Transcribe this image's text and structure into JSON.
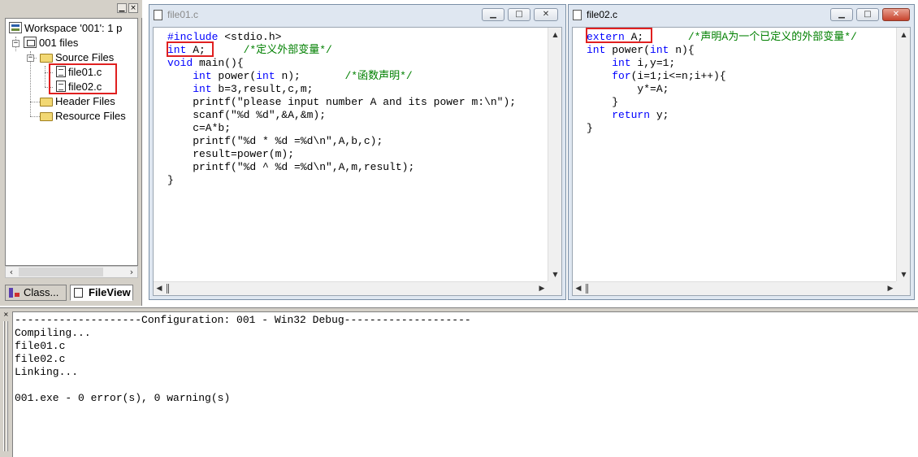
{
  "workspace": {
    "root_label": "Workspace '001': 1 p",
    "project_label": "001 files",
    "folders": {
      "source": "Source Files",
      "header": "Header Files",
      "resource": "Resource Files"
    },
    "files": [
      "file01.c",
      "file02.c"
    ],
    "tabs": [
      {
        "label": "Class...",
        "icon": "class-view-icon",
        "active": false
      },
      {
        "label": "FileView",
        "icon": "file-view-icon",
        "active": true
      }
    ]
  },
  "editors": [
    {
      "title": "file01.c",
      "active": false,
      "lines": [
        [
          {
            "t": "#include",
            "c": "kw"
          },
          {
            "t": " <stdio.h>",
            "c": ""
          }
        ],
        [
          {
            "t": "int",
            "c": "kw"
          },
          {
            "t": " A;      ",
            "c": ""
          },
          {
            "t": "/*定义外部变量*/",
            "c": "cm"
          }
        ],
        [
          {
            "t": "void",
            "c": "kw"
          },
          {
            "t": " main(){",
            "c": ""
          }
        ],
        [
          {
            "t": "    ",
            "c": ""
          },
          {
            "t": "int",
            "c": "kw"
          },
          {
            "t": " power(",
            "c": ""
          },
          {
            "t": "int",
            "c": "kw"
          },
          {
            "t": " n);       ",
            "c": ""
          },
          {
            "t": "/*函数声明*/",
            "c": "cm"
          }
        ],
        [
          {
            "t": "    ",
            "c": ""
          },
          {
            "t": "int",
            "c": "kw"
          },
          {
            "t": " b=3,result,c,m;",
            "c": ""
          }
        ],
        [
          {
            "t": "    printf(\"please input number A and its power m:\\n\");",
            "c": ""
          }
        ],
        [
          {
            "t": "    scanf(\"%d %d\",&A,&m);",
            "c": ""
          }
        ],
        [
          {
            "t": "    c=A*b;",
            "c": ""
          }
        ],
        [
          {
            "t": "    printf(\"%d * %d =%d\\n\",A,b,c);",
            "c": ""
          }
        ],
        [
          {
            "t": "    result=power(m);",
            "c": ""
          }
        ],
        [
          {
            "t": "    printf(\"%d ^ %d =%d\\n\",A,m,result);",
            "c": ""
          }
        ],
        [
          {
            "t": "}",
            "c": ""
          }
        ]
      ]
    },
    {
      "title": "file02.c",
      "active": true,
      "lines": [
        [
          {
            "t": "extern",
            "c": "kw"
          },
          {
            "t": " A;       ",
            "c": ""
          },
          {
            "t": "/*声明A为一个已定义的外部变量*/",
            "c": "cm"
          }
        ],
        [
          {
            "t": "int",
            "c": "kw"
          },
          {
            "t": " power(",
            "c": ""
          },
          {
            "t": "int",
            "c": "kw"
          },
          {
            "t": " n){",
            "c": ""
          }
        ],
        [
          {
            "t": "    ",
            "c": ""
          },
          {
            "t": "int",
            "c": "kw"
          },
          {
            "t": " i,y=1;",
            "c": ""
          }
        ],
        [
          {
            "t": "    ",
            "c": ""
          },
          {
            "t": "for",
            "c": "kw"
          },
          {
            "t": "(i=1;i<=n;i++){",
            "c": ""
          }
        ],
        [
          {
            "t": "        y*=A;",
            "c": ""
          }
        ],
        [
          {
            "t": "    }",
            "c": ""
          }
        ],
        [
          {
            "t": "    ",
            "c": ""
          },
          {
            "t": "return",
            "c": "kw"
          },
          {
            "t": " y;",
            "c": ""
          }
        ],
        [
          {
            "t": "}",
            "c": ""
          }
        ]
      ]
    }
  ],
  "output": {
    "lines": [
      "--------------------Configuration: 001 - Win32 Debug--------------------",
      "Compiling...",
      "file01.c",
      "file02.c",
      "Linking...",
      "",
      "001.exe - 0 error(s), 0 warning(s)"
    ]
  },
  "colors": {
    "keyword": "#0000ff",
    "comment": "#008000",
    "highlight": "#e02020"
  }
}
